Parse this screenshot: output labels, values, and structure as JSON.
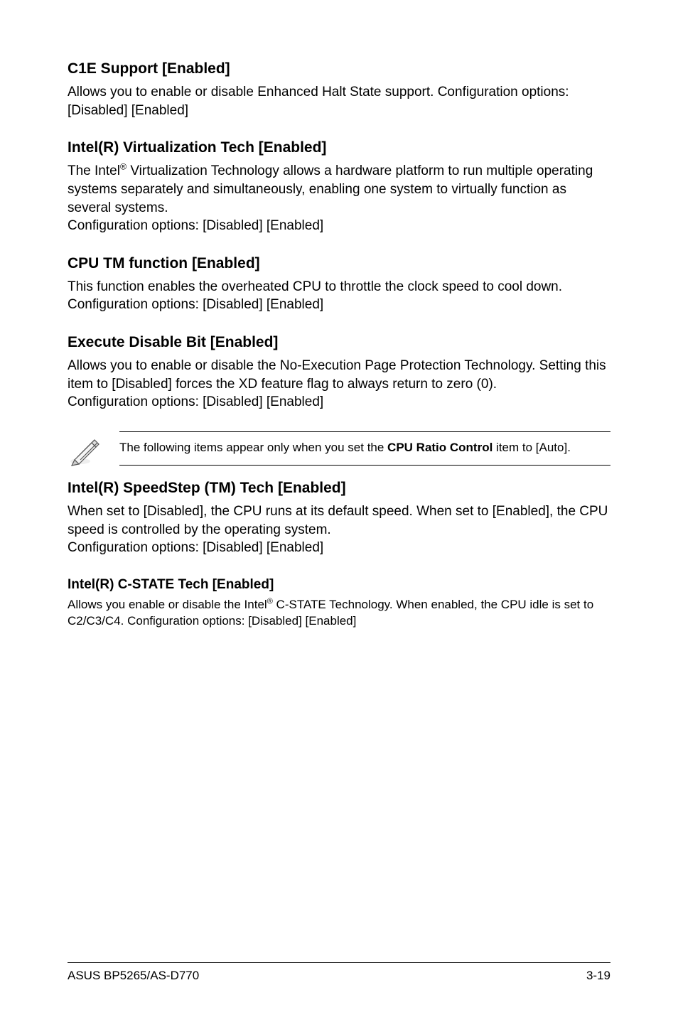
{
  "sections": {
    "c1e": {
      "heading": "C1E Support [Enabled]",
      "body": "Allows you to enable or disable Enhanced Halt State support. Configuration options: [Disabled] [Enabled]"
    },
    "virt": {
      "heading": "Intel(R) Virtualization Tech [Enabled]",
      "body_pre": "The Intel",
      "body_sup": "®",
      "body_post": " Virtualization Technology allows a hardware platform to run multiple operating systems separately and simultaneously, enabling one system to virtually function as several systems.",
      "body_cfg": "Configuration options: [Disabled] [Enabled]"
    },
    "tm": {
      "heading": "CPU TM function [Enabled]",
      "body": "This function enables the overheated CPU to throttle the clock speed to cool down. Configuration options: [Disabled] [Enabled]"
    },
    "xd": {
      "heading": "Execute Disable Bit [Enabled]",
      "body": "Allows you to enable or disable the No-Execution Page Protection Technology. Setting this item to [Disabled] forces the XD feature flag to always return to zero (0).",
      "body_cfg": "Configuration options: [Disabled] [Enabled]"
    },
    "note": {
      "pre": "The following items appear only when you set the ",
      "bold": "CPU Ratio Control",
      "post": " item to [Auto]."
    },
    "speedstep": {
      "heading": "Intel(R) SpeedStep (TM) Tech [Enabled]",
      "body": "When set to [Disabled], the CPU runs at its default speed. When set to [Enabled], the CPU speed is controlled by the operating system.",
      "body_cfg": "Configuration options: [Disabled] [Enabled]"
    },
    "cstate": {
      "heading": "Intel(R) C-STATE Tech [Enabled]",
      "body_pre": "Allows you enable or disable the Intel",
      "body_sup": "®",
      "body_post": " C-STATE Technology. When enabled, the CPU idle is set to C2/C3/C4. Configuration options: [Disabled] [Enabled]"
    }
  },
  "footer": {
    "left": "ASUS BP5265/AS-D770",
    "right": "3-19"
  }
}
